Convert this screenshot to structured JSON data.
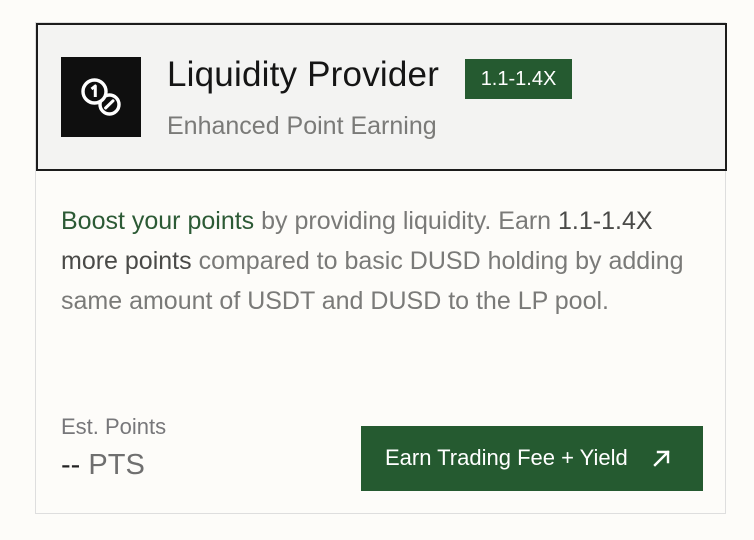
{
  "card": {
    "title": "Liquidity Provider",
    "badge": "1.1-1.4X",
    "subtitle": "Enhanced Point Earning",
    "logo_icon": "coin-swap-icon",
    "description": {
      "highlight": "Boost your points",
      "part1": " by providing liquidity. Earn ",
      "emphasis": "1.1-1.4X more points",
      "part2": " compared to basic DUSD holding by adding same amount of USDT and DUSD to the LP pool."
    },
    "estimate": {
      "label": "Est. Points",
      "value": "--",
      "unit": "PTS"
    },
    "cta": {
      "label": "Earn Trading Fee + Yield",
      "icon": "arrow-up-right-icon"
    },
    "colors": {
      "accent": "#255a30",
      "header_bg": "#f3f3f2",
      "logo_bg": "#0f0f0f"
    }
  }
}
